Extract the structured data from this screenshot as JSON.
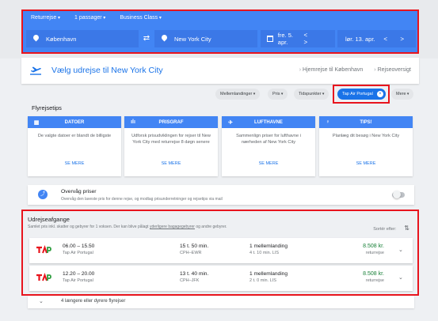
{
  "search": {
    "trip_type": "Returrejse",
    "passengers": "1 passager",
    "cabin": "Business Class",
    "origin": "København",
    "destination": "New York City",
    "depart_date": "fre. 5. apr.",
    "return_date": "lør. 13. apr.",
    "nav_prev": "<",
    "nav_next": ">"
  },
  "header": {
    "title": "Vælg udrejse til New York City",
    "breadcrumbs": [
      "Hjemrejse til København",
      "Rejseoversigt"
    ]
  },
  "filters": {
    "stops": "Mellemlandinger",
    "price": "Pris",
    "times": "Tidspunkter",
    "airline_active": "Tap Air Portugal",
    "more": "Mere",
    "clear_icon": "×"
  },
  "tips": {
    "title": "Flyrejsetips",
    "cards": [
      {
        "icon": "calendar-icon",
        "glyph": "▦",
        "title": "DATOER",
        "body": "De valgte datoer er blandt de billigste",
        "link": "SE MERE"
      },
      {
        "icon": "bar-chart-icon",
        "glyph": "ılı",
        "title": "PRISGRAF",
        "body": "Udforsk prisudviklingen for rejser til New York City med returrejse 8 døgn senere",
        "link": "SE MERE"
      },
      {
        "icon": "airplane-icon",
        "glyph": "✈",
        "title": "LUFTHAVNE",
        "body": "Sammenlign priser for lufthavne i nærheden af New York City",
        "link": "SE MERE"
      },
      {
        "icon": "lightbulb-icon",
        "glyph": "♀",
        "title": "TIPS!",
        "body": "Planlæg dit besøg i New York City",
        "link": "SE MERE"
      }
    ]
  },
  "price_watch": {
    "title": "Overvåg priser",
    "subtitle": "Overvåg den laveste pris for denne rejse, og modtag prisunderretninger og rejsetips via mail"
  },
  "departures": {
    "title": "Udrejseafgange",
    "subtitle_pre": "Samlet pris inkl. skatter og gebyrer for 1 voksen. Der kan blive pålagt ",
    "subtitle_link": "yderligere bagagegebyrer",
    "subtitle_post": " og andre gebyrer.",
    "sort_label": "Sortér efter:",
    "flights": [
      {
        "times": "06.00 – 15.50",
        "airline": "Tap Air Portugal",
        "duration": "15 t. 50 min.",
        "route": "CPH–EWR",
        "stops": "1 mellemlanding",
        "layover": "4 t. 10 min. LIS",
        "price": "8.508 kr.",
        "price_note": "returrejse"
      },
      {
        "times": "12.20 – 20.00",
        "airline": "Tap Air Portugal",
        "duration": "13 t. 40 min.",
        "route": "CPH–JFK",
        "stops": "1 mellemlanding",
        "layover": "2 t. 0 min. LIS",
        "price": "8.508 kr.",
        "price_note": "returrejse"
      }
    ],
    "more_flights": "4 længere eller dyrere flyrejser"
  },
  "colors": {
    "accent": "#4285f4",
    "highlight": "#e8141d",
    "price_green": "#188038",
    "tap_red": "#e8141d",
    "tap_green": "#2e9e3f"
  }
}
